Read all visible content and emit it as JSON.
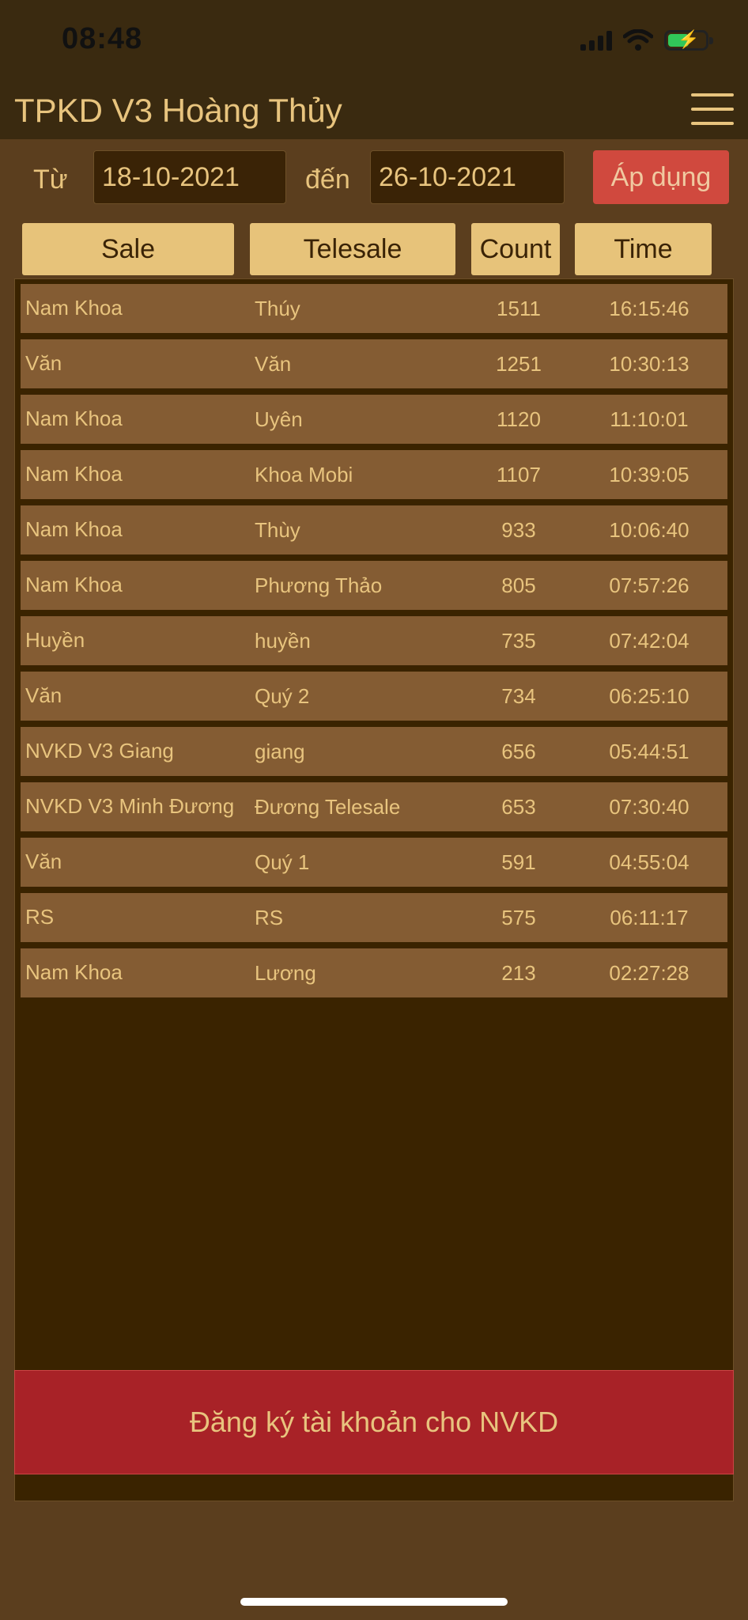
{
  "status_bar": {
    "time": "08:48"
  },
  "header": {
    "title": "TPKD V3 Hoàng Thủy"
  },
  "filter": {
    "from_label": "Từ",
    "from_value": "18-10-2021",
    "to_label": "đến",
    "to_value": "26-10-2021",
    "apply_label": "Áp dụng"
  },
  "columns": [
    "Sale",
    "Telesale",
    "Count",
    "Time"
  ],
  "rows": [
    {
      "sale": "Nam Khoa",
      "telesale": "Thúy",
      "count": "1511",
      "time": "16:15:46"
    },
    {
      "sale": "Văn",
      "telesale": "Văn",
      "count": "1251",
      "time": "10:30:13"
    },
    {
      "sale": "Nam Khoa",
      "telesale": "Uyên",
      "count": "1120",
      "time": "11:10:01"
    },
    {
      "sale": "Nam Khoa",
      "telesale": "Khoa Mobi",
      "count": "1107",
      "time": "10:39:05"
    },
    {
      "sale": "Nam Khoa",
      "telesale": "Thùy",
      "count": "933",
      "time": "10:06:40"
    },
    {
      "sale": "Nam Khoa",
      "telesale": "Phương Thảo",
      "count": "805",
      "time": "07:57:26"
    },
    {
      "sale": "Huyền",
      "telesale": "huyền",
      "count": "735",
      "time": "07:42:04"
    },
    {
      "sale": "Văn",
      "telesale": "Quý 2",
      "count": "734",
      "time": "06:25:10"
    },
    {
      "sale": "NVKD V3 Giang",
      "telesale": "giang",
      "count": "656",
      "time": "05:44:51"
    },
    {
      "sale": "NVKD V3 Minh Đương",
      "telesale": "Đương Telesale",
      "count": "653",
      "time": "07:30:40"
    },
    {
      "sale": "Văn",
      "telesale": "Quý 1",
      "count": "591",
      "time": "04:55:04"
    },
    {
      "sale": "RS",
      "telesale": "RS",
      "count": "575",
      "time": "06:11:17"
    },
    {
      "sale": "Nam Khoa",
      "telesale": "Lương",
      "count": "213",
      "time": "02:27:28"
    }
  ],
  "footer": {
    "register_label": "Đăng ký tài khoản cho NVKD"
  },
  "icons": [
    "signal-icon",
    "wifi-icon",
    "battery-charging-icon",
    "hamburger-menu-icon"
  ],
  "colors": {
    "background": "#3a2a10",
    "panel": "#5b3e1e",
    "row": "#845c33",
    "header_button": "#e7c37a",
    "apply_button": "#d0493e",
    "register_button": "#a82227",
    "text": "#e8c47e"
  }
}
